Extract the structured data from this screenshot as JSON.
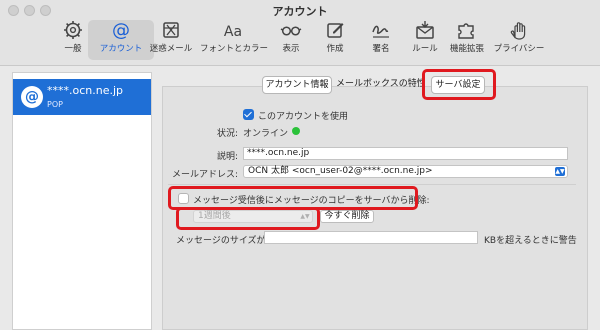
{
  "window": {
    "title": "アカウント"
  },
  "toolbar": [
    {
      "label": "一般",
      "icon": "gear-icon"
    },
    {
      "label": "アカウント",
      "icon": "at-icon",
      "active": true
    },
    {
      "label": "迷惑メール",
      "icon": "junk-mail-icon"
    },
    {
      "label": "フォントとカラー",
      "icon": "font-icon"
    },
    {
      "label": "表示",
      "icon": "glasses-icon"
    },
    {
      "label": "作成",
      "icon": "compose-icon"
    },
    {
      "label": "署名",
      "icon": "signature-icon"
    },
    {
      "label": "ルール",
      "icon": "rules-icon"
    },
    {
      "label": "機能拡張",
      "icon": "puzzle-icon"
    },
    {
      "label": "プライバシー",
      "icon": "hand-icon"
    }
  ],
  "sidebar": {
    "accounts": [
      {
        "name": "****.ocn.ne.jp",
        "type": "POP",
        "icon_char": "@"
      }
    ]
  },
  "tabs": {
    "account_info": "アカウント情報",
    "mailbox_behavior": "メールボックスの特性",
    "server_settings": "サーバ設定"
  },
  "form": {
    "enable_account": "このアカウントを使用",
    "status_label": "状況:",
    "status_value": "オンライン",
    "description_label": "説明:",
    "description_value": "****.ocn.ne.jp",
    "email_label": "メールアドレス:",
    "email_value": "OCN 太郎 <ocn_user-02@****.ocn.ne.jp>",
    "delete_copy_label": "メッセージ受信後にメッセージのコピーをサーバから削除:",
    "delete_period_value": "1週間後",
    "delete_now_button": "今すぐ削除",
    "message_size_label": "メッセージのサイズが",
    "message_size_value": "",
    "message_size_suffix": "KBを超えるときに警告"
  },
  "colors": {
    "accent": "#1f6fd6",
    "highlight": "#e0191f",
    "status_online": "#2bc23a"
  }
}
